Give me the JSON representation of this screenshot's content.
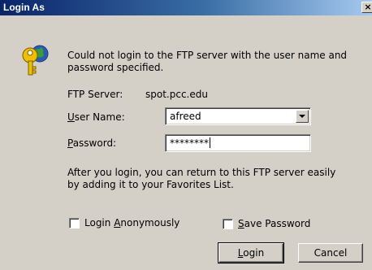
{
  "window": {
    "title": "Login As",
    "close_glyph": "×"
  },
  "icon": {
    "name": "key-icon",
    "colors": {
      "key": "#f0c000",
      "globe": "#2a5db0"
    }
  },
  "message": {
    "line1": "Could not login to the FTP server with the user name and",
    "line2": "password specified."
  },
  "server": {
    "label": "FTP Server:",
    "value": "spot.pcc.edu"
  },
  "username": {
    "label_mnemonic": "U",
    "label_rest": "ser Name:",
    "value": "afreed"
  },
  "password": {
    "label_mnemonic": "P",
    "label_rest": "assword:",
    "value": "********"
  },
  "info": {
    "line1": "After you login, you can return to this FTP server easily",
    "line2": "by adding it to your Favorites List."
  },
  "login_anonymously": {
    "label_pre": "Login ",
    "label_mnemonic": "A",
    "label_rest": "nonymously",
    "checked": false
  },
  "save_password": {
    "label_mnemonic": "S",
    "label_rest": "ave Password",
    "checked": false
  },
  "buttons": {
    "login": {
      "label_mnemonic": "L",
      "label_rest": "ogin"
    },
    "cancel": {
      "label": "Cancel"
    }
  }
}
